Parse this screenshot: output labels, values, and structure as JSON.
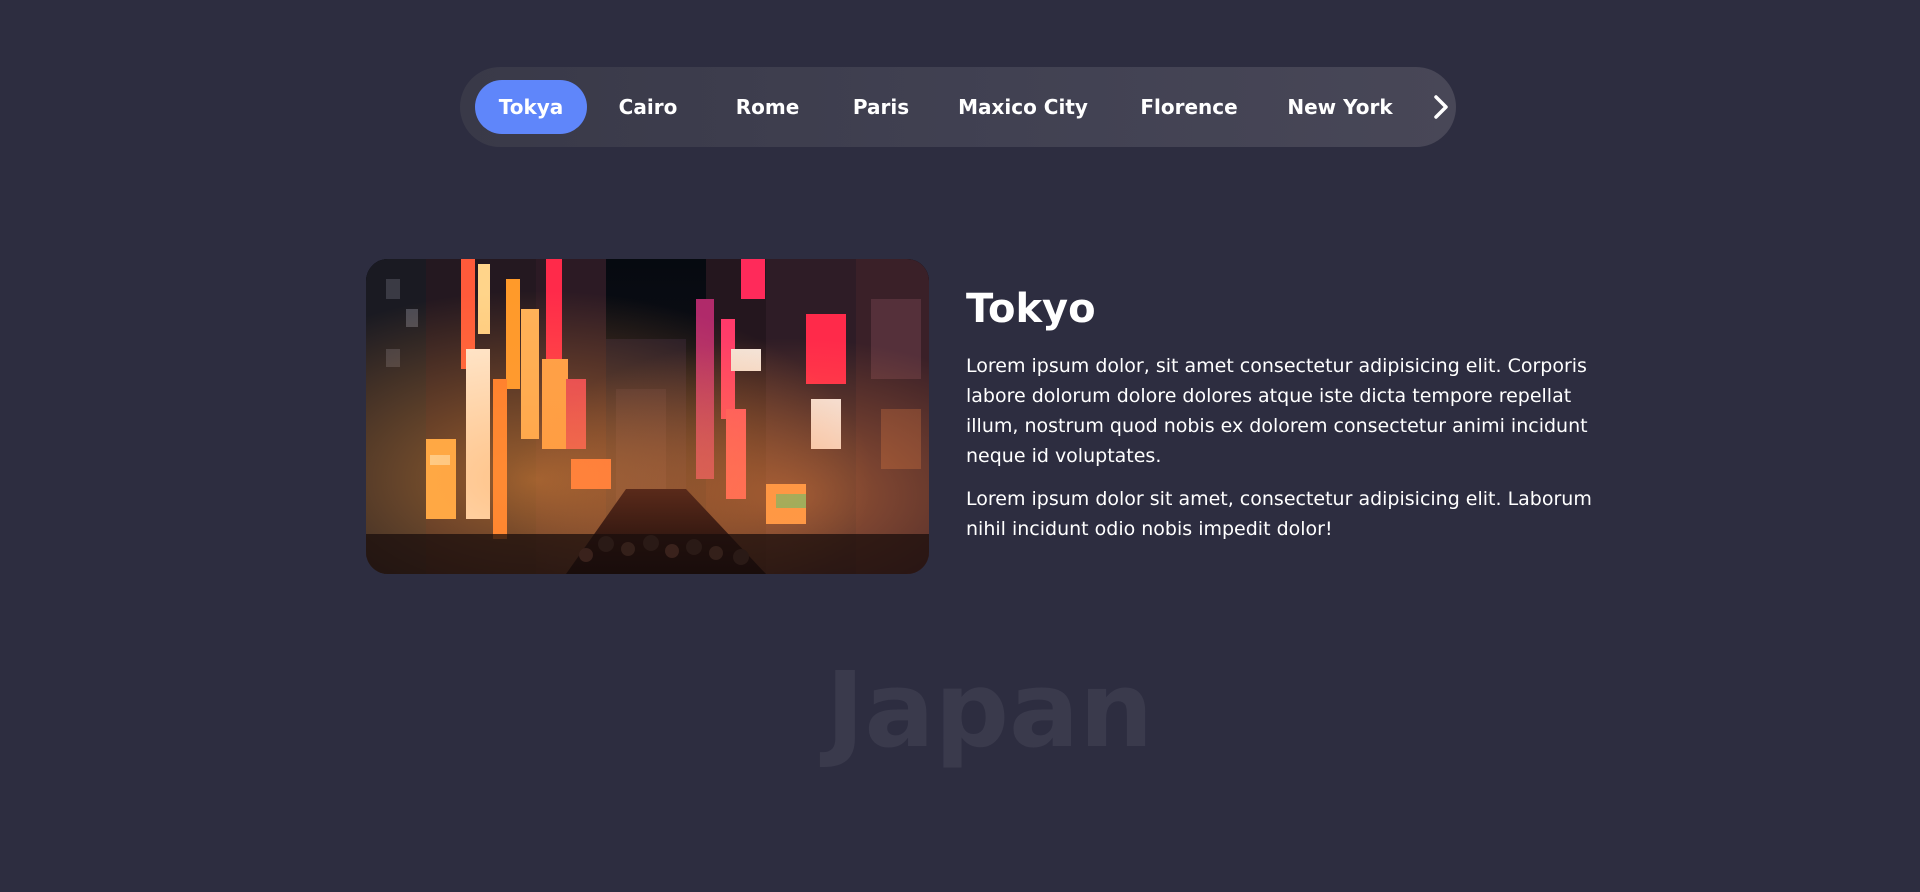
{
  "nav": {
    "tabs": [
      {
        "label": "Tokya",
        "active": true
      },
      {
        "label": "Cairo",
        "active": false
      },
      {
        "label": "Rome",
        "active": false
      },
      {
        "label": "Paris",
        "active": false
      },
      {
        "label": "Maxico City",
        "active": false
      },
      {
        "label": "Florence",
        "active": false
      },
      {
        "label": "New York",
        "active": false
      }
    ],
    "next_icon": "chevron-right-icon"
  },
  "content": {
    "title": "Tokyo",
    "paragraphs": [
      "Lorem ipsum dolor, sit amet consectetur adipisicing elit. Corporis labore dolorum dolore dolores atque iste dicta tempore repellat illum, nostrum quod nobis ex dolorem consectetur animi incidunt neque id voluptates.",
      "Lorem ipsum dolor sit amet, consectetur adipisicing elit. Laborum nihil incidunt odio nobis impedit dolor!"
    ],
    "country": "Japan"
  },
  "colors": {
    "background": "#2d2d40",
    "tab_bar": "#414152",
    "accent": "#5f86fa",
    "text": "#ffffff",
    "watermark": "#3a3a4c"
  }
}
